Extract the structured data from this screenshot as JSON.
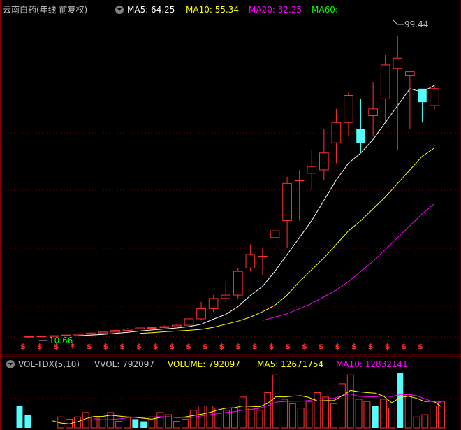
{
  "header": {
    "title": "云南白药(年线 前复权)",
    "ma5": "MA5: 64.25",
    "ma10": "MA10: 55.34",
    "ma20": "MA20: 32.25",
    "ma60": "MA60: -"
  },
  "vol_header": {
    "title": "VOL-TDX(5,10)",
    "vvol": "VVOL: 792097",
    "volume": "VOLUME: 792097",
    "ma5": "MA5: 12671754",
    "ma10": "MA10: 12832141"
  },
  "annotations": {
    "high_label": "99.44",
    "low_label": "10.66"
  },
  "colors": {
    "up": "#ff3232",
    "down": "#54fcfc",
    "ma5": "#ffffff",
    "ma10": "#ffff00",
    "ma20": "#ff00ff",
    "ma60": "#00ff00",
    "grid": "#800000",
    "bg": "#000000"
  },
  "chart_data": [
    {
      "type": "candlestick",
      "title": "云南白药(年线 前复权)",
      "candles": [
        {
          "o": 10.7,
          "h": 10.9,
          "l": 10.66,
          "c": 10.8
        },
        {
          "o": 10.8,
          "h": 11.0,
          "l": 10.7,
          "c": 10.9
        },
        {
          "o": 10.9,
          "h": 11.1,
          "l": 10.8,
          "c": 11.0
        },
        {
          "o": 11.0,
          "h": 11.3,
          "l": 10.9,
          "c": 11.2
        },
        {
          "o": 11.2,
          "h": 11.6,
          "l": 11.1,
          "c": 11.5
        },
        {
          "o": 11.5,
          "h": 12.0,
          "l": 11.4,
          "c": 11.8
        },
        {
          "o": 11.8,
          "h": 12.3,
          "l": 11.7,
          "c": 12.1
        },
        {
          "o": 12.1,
          "h": 12.8,
          "l": 12.0,
          "c": 12.6
        },
        {
          "o": 12.6,
          "h": 13.2,
          "l": 12.4,
          "c": 13.0
        },
        {
          "o": 13.0,
          "h": 13.6,
          "l": 12.8,
          "c": 13.3
        },
        {
          "o": 13.3,
          "h": 13.8,
          "l": 13.0,
          "c": 13.4
        },
        {
          "o": 13.4,
          "h": 14.0,
          "l": 13.2,
          "c": 13.7
        },
        {
          "o": 13.7,
          "h": 14.4,
          "l": 13.5,
          "c": 14.1
        },
        {
          "o": 14.1,
          "h": 17.0,
          "l": 13.8,
          "c": 16.0
        },
        {
          "o": 16.0,
          "h": 21.0,
          "l": 15.5,
          "c": 19.0
        },
        {
          "o": 19.0,
          "h": 23.0,
          "l": 18.0,
          "c": 22.0
        },
        {
          "o": 22.0,
          "h": 27.0,
          "l": 21.0,
          "c": 23.0
        },
        {
          "o": 23.0,
          "h": 31.0,
          "l": 22.0,
          "c": 30.0
        },
        {
          "o": 31.0,
          "h": 38.0,
          "l": 30.0,
          "c": 35.0
        },
        {
          "o": 34.5,
          "h": 37.0,
          "l": 29.0,
          "c": 34.5
        },
        {
          "o": 40.0,
          "h": 46.0,
          "l": 38.0,
          "c": 42.0
        },
        {
          "o": 45.0,
          "h": 58.0,
          "l": 37.0,
          "c": 56.0
        },
        {
          "o": 57.0,
          "h": 60.0,
          "l": 45.0,
          "c": 57.0
        },
        {
          "o": 59.0,
          "h": 66.0,
          "l": 54.0,
          "c": 61.0
        },
        {
          "o": 60.0,
          "h": 72.0,
          "l": 57.0,
          "c": 65.0
        },
        {
          "o": 68.0,
          "h": 78.0,
          "l": 62.0,
          "c": 74.0
        },
        {
          "o": 74.0,
          "h": 83.0,
          "l": 70.0,
          "c": 82.0
        },
        {
          "o": 72.0,
          "h": 81.0,
          "l": 65.0,
          "c": 68.0
        },
        {
          "o": 76.0,
          "h": 86.0,
          "l": 70.0,
          "c": 78.0
        },
        {
          "o": 81.0,
          "h": 94.0,
          "l": 74.0,
          "c": 91.0
        },
        {
          "o": 90.0,
          "h": 99.44,
          "l": 66.0,
          "c": 93.0
        },
        {
          "o": 88.0,
          "h": 87.0,
          "l": 72.0,
          "c": 89.0
        },
        {
          "o": 84.0,
          "h": 84.0,
          "l": 74.0,
          "c": 80.0
        },
        {
          "o": 79.0,
          "h": 85.0,
          "l": 78.0,
          "c": 84.0
        }
      ],
      "ma5": [
        null,
        null,
        null,
        null,
        11.0,
        11.2,
        11.4,
        11.7,
        12.0,
        12.4,
        12.7,
        13.0,
        13.3,
        13.7,
        14.4,
        15.9,
        17.3,
        19.6,
        22.9,
        25.6,
        30.0,
        35.0,
        40.0,
        45.0,
        51.0,
        57.0,
        62.0,
        65.0,
        69.0,
        74.0,
        79.0,
        84.0,
        83.0,
        85.0
      ],
      "ma10": [
        null,
        null,
        null,
        null,
        null,
        null,
        null,
        null,
        null,
        11.7,
        11.9,
        12.2,
        12.4,
        12.6,
        12.9,
        13.5,
        14.4,
        15.3,
        16.5,
        18.1,
        20.0,
        23.0,
        27.0,
        30.5,
        34.0,
        38.0,
        42.0,
        45.0,
        48.5,
        52.0,
        56.0,
        60.0,
        64.0,
        66.5
      ],
      "ma20": [
        null,
        null,
        null,
        null,
        null,
        null,
        null,
        null,
        null,
        null,
        null,
        null,
        null,
        null,
        null,
        null,
        null,
        null,
        null,
        15.5,
        16.5,
        17.5,
        19.0,
        20.5,
        22.5,
        24.5,
        27.0,
        30.0,
        33.0,
        36.5,
        40.0,
        43.5,
        47.0,
        50.0
      ],
      "high": 99.44,
      "low": 10.66,
      "ylim": [
        10,
        104
      ]
    },
    {
      "type": "bar",
      "title": "VOL-TDX(5,10)",
      "values": [
        5.0,
        3.0,
        0,
        0,
        0,
        2.5,
        2.0,
        2.5,
        3.5,
        2.5,
        2.5,
        3.5,
        1.5,
        2.5,
        2.0,
        1.5,
        2.5,
        3.5,
        3.0,
        1.5,
        2.0,
        4.0,
        5.0,
        5.0,
        4.5,
        4.0,
        4.5,
        7.0,
        4.5,
        4.0,
        8.0,
        12.0,
        6.5,
        5.5,
        4.5,
        6.0,
        8.0,
        7.0,
        5.5,
        10.0,
        12.0,
        6.5,
        6.0,
        5.0,
        6.5,
        4.5,
        12.5,
        7.5,
        2.5,
        3.0,
        5.0,
        6.0
      ],
      "down": [
        true,
        true,
        false,
        false,
        false,
        false,
        false,
        false,
        false,
        false,
        false,
        false,
        false,
        false,
        true,
        true,
        false,
        false,
        false,
        false,
        false,
        false,
        false,
        false,
        false,
        false,
        false,
        false,
        false,
        false,
        false,
        false,
        false,
        false,
        false,
        false,
        false,
        false,
        false,
        false,
        false,
        false,
        false,
        true,
        false,
        false,
        true,
        false,
        false,
        false,
        false,
        false
      ]
    }
  ]
}
